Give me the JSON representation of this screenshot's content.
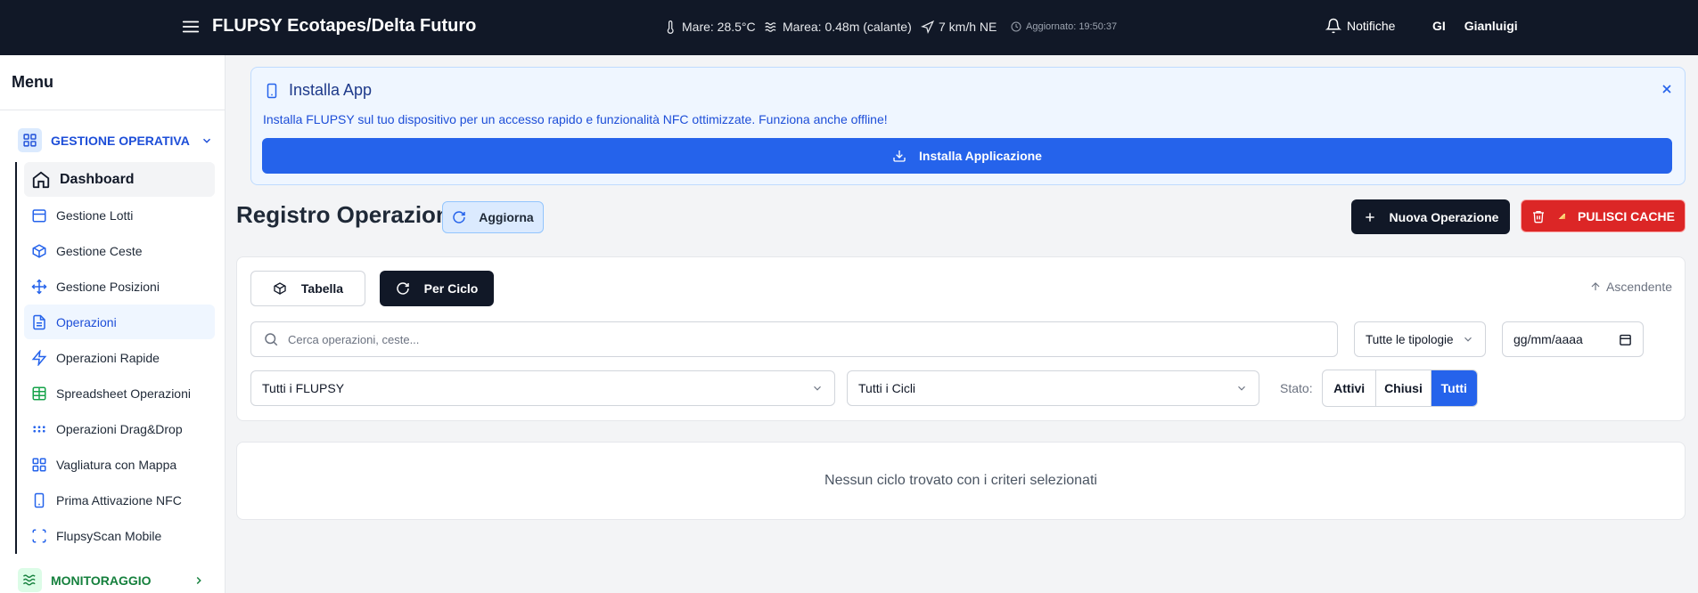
{
  "header": {
    "title": "FLUPSY Ecotapes/Delta Futuro",
    "weather": {
      "sea_temp": "Mare: 28.5°C",
      "tide": "Marea: 0.48m (calante)",
      "wind": "7 km/h NE",
      "updated": "Aggiornato: 19:50:37"
    },
    "notifications_label": "Notifiche",
    "user_initials": "GI",
    "user_name": "Gianluigi"
  },
  "sidebar": {
    "menu_title": "Menu",
    "groups": [
      {
        "label": "GESTIONE OPERATIVA",
        "icon": "grid-icon",
        "expanded": true,
        "color": "#1d4ed8"
      },
      {
        "label": "MONITORAGGIO",
        "icon": "waves-icon",
        "expanded": false,
        "color": "#15803d"
      }
    ],
    "items": [
      {
        "label": "Dashboard",
        "icon": "home-icon"
      },
      {
        "label": "Gestione Lotti",
        "icon": "calendar-icon"
      },
      {
        "label": "Gestione Ceste",
        "icon": "box-icon"
      },
      {
        "label": "Gestione Posizioni",
        "icon": "move-icon"
      },
      {
        "label": "Operazioni",
        "icon": "document-icon",
        "active": true
      },
      {
        "label": "Operazioni Rapide",
        "icon": "zap-icon"
      },
      {
        "label": "Spreadsheet Operazioni",
        "icon": "table-icon"
      },
      {
        "label": "Operazioni Drag&Drop",
        "icon": "grip-icon"
      },
      {
        "label": "Vagliatura con Mappa",
        "icon": "grid-icon"
      },
      {
        "label": "Prima Attivazione NFC",
        "icon": "smartphone-icon"
      },
      {
        "label": "FlupsyScan Mobile",
        "icon": "scan-icon"
      }
    ]
  },
  "install_banner": {
    "title": "Installa App",
    "description": "Installa FLUPSY sul tuo dispositivo per un accesso rapido e funzionalità NFC ottimizzate. Funziona anche offline!",
    "button_label": "Installa Applicazione"
  },
  "page": {
    "title": "Registro Operazioni",
    "refresh_label": "Aggiorna",
    "new_operation_label": "Nuova Operazione",
    "clear_cache_label": "PULISCI CACHE"
  },
  "filters": {
    "view_buttons": [
      {
        "label": "Tabella",
        "selected": false
      },
      {
        "label": "Per Ciclo",
        "selected": true
      }
    ],
    "sort_label": "Ascendente",
    "search_placeholder": "Cerca operazioni, ceste...",
    "type_select": "Tutte le tipologie",
    "date_placeholder": "gg/mm/aaaa",
    "flupsy_select": "Tutti i FLUPSY",
    "cycle_select": "Tutti i Cicli",
    "status_label": "Stato:",
    "status_options": [
      {
        "label": "Attivi",
        "selected": false
      },
      {
        "label": "Chiusi",
        "selected": false
      },
      {
        "label": "Tutti",
        "selected": true
      }
    ]
  },
  "empty_message": "Nessun ciclo trovato con i criteri selezionati",
  "colors": {
    "header_bg": "#111827",
    "primary": "#2563eb",
    "danger": "#dc2626",
    "monitoring_green": "#15803d"
  }
}
